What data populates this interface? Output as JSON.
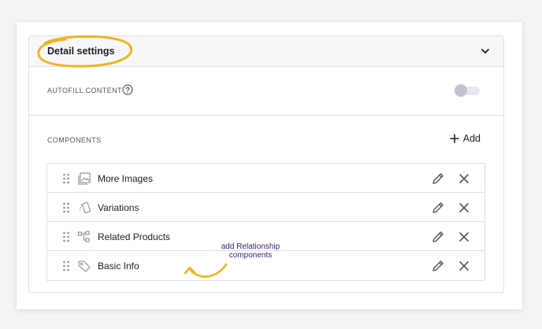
{
  "detail_settings": {
    "title": "Detail settings",
    "autofill_label": "AUTOFILL CONTENT",
    "autofill_enabled": false,
    "components_label": "COMPONENTS",
    "add_label": "Add"
  },
  "components": [
    {
      "label": "More Images",
      "icon": "image-icon"
    },
    {
      "label": "Variations",
      "icon": "variations-icon"
    },
    {
      "label": "Related Products",
      "icon": "hierarchy-icon"
    },
    {
      "label": "Basic Info",
      "icon": "tag-icon"
    }
  ],
  "annotation": {
    "line1": "add Relationship",
    "line2": "components"
  },
  "colors": {
    "highlight": "#f0b41f",
    "toggle_off": "#c4c1d2",
    "icon_gray": "#5c5b6e"
  }
}
